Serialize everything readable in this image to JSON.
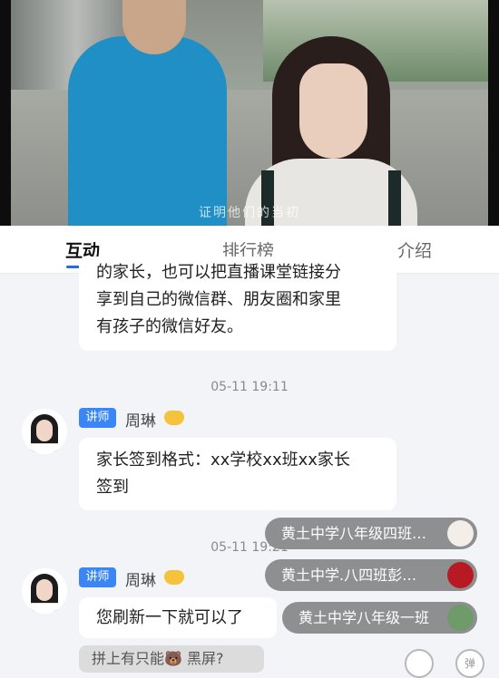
{
  "video": {
    "subtitle": "证明他们的当初"
  },
  "tabs": [
    {
      "label": "互动"
    },
    {
      "label": "排行榜"
    },
    {
      "label": "介绍"
    }
  ],
  "messages": {
    "first": {
      "line1": "的家长，也可以把直播课堂链接分",
      "line2": "享到自己的微信群、朋友圈和家里",
      "line3": "有孩子的微信好友。"
    },
    "time1": "05-11 19:11",
    "msg2": {
      "badge": "讲师",
      "name": "周琳",
      "line1": "家长签到格式：xx学校xx班xx家长",
      "line2": "签到"
    },
    "time2": "05-11 19:21",
    "msg3": {
      "badge": "讲师",
      "name": "周琳",
      "text": "您刷新一下就可以了"
    },
    "partial": "拼上有只能🐻 黑屏?"
  },
  "notifications": [
    {
      "text": "黄土中学八年级四班…"
    },
    {
      "text": "黄土中学.八四班彭…"
    },
    {
      "text": "黄土中学八年级一班"
    }
  ],
  "bottom": {
    "right_btn": "弹"
  }
}
